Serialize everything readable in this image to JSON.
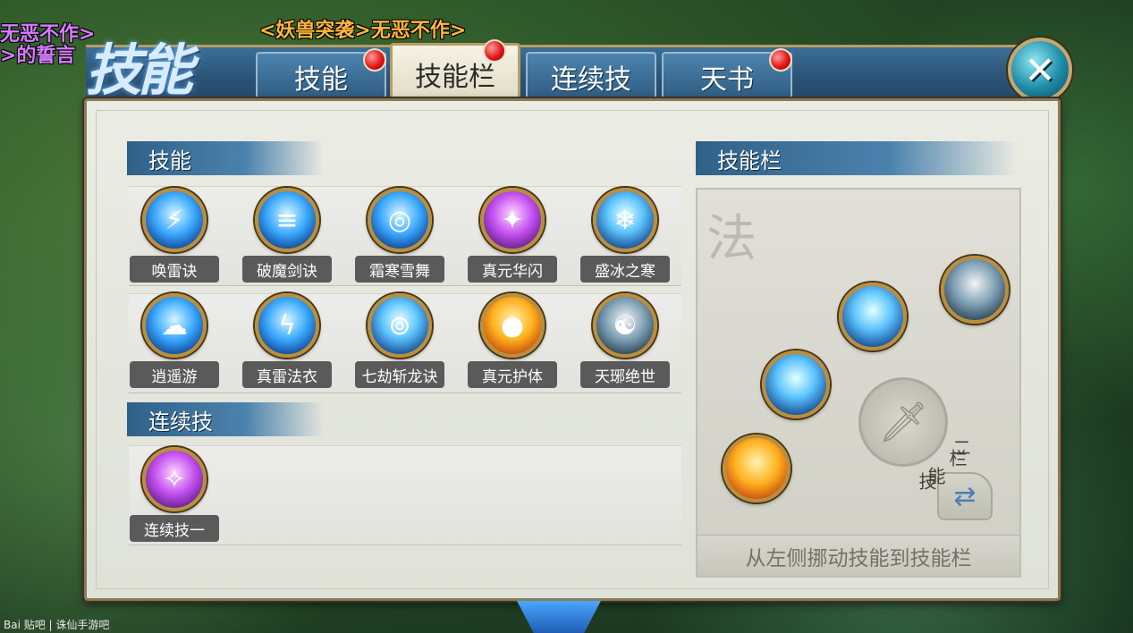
{
  "header": {
    "title_glyph": "技能",
    "tabs": [
      {
        "label": "技能",
        "badge": true,
        "active": false
      },
      {
        "label": "技能栏",
        "badge": true,
        "active": true
      },
      {
        "label": "连续技",
        "badge": false,
        "active": false
      },
      {
        "label": "天书",
        "badge": true,
        "active": false
      }
    ],
    "close_label": "✕"
  },
  "chat": {
    "line1": "<妖兽突袭>无恶不作>",
    "line_left1": "无恶不作>",
    "line_left2": ">的誓言"
  },
  "skills_section": {
    "title": "技能",
    "rows": [
      [
        {
          "name": "唤雷诀",
          "icon": "lightning-icon",
          "style": "blue"
        },
        {
          "name": "破魔剑诀",
          "icon": "sword-beam-icon",
          "style": "blue"
        },
        {
          "name": "霜寒雪舞",
          "icon": "vortex-icon",
          "style": "blue"
        },
        {
          "name": "真元华闪",
          "icon": "purple-burst-icon",
          "style": "purple"
        },
        {
          "name": "盛冰之寒",
          "icon": "ice-crystal-icon",
          "style": "ice"
        }
      ],
      [
        {
          "name": "逍遥游",
          "icon": "wind-icon",
          "style": "blue"
        },
        {
          "name": "真雷法衣",
          "icon": "thunder-armor-icon",
          "style": "blue"
        },
        {
          "name": "七劫斩龙诀",
          "icon": "ripple-icon",
          "style": "ice"
        },
        {
          "name": "真元护体",
          "icon": "orange-orb-icon",
          "style": "orange"
        },
        {
          "name": "天琊绝世",
          "icon": "taiji-icon",
          "style": "taiji"
        }
      ]
    ]
  },
  "combo_section": {
    "title": "连续技",
    "items": [
      {
        "name": "连续技一",
        "icon": "purple-crystal-icon",
        "style": "purple"
      }
    ]
  },
  "skillbar_section": {
    "title": "技能栏",
    "calligraphy": "法",
    "hint": "从左侧挪动技能到技能栏",
    "switch_label": "技能栏二",
    "switch_chars": [
      "技",
      "能",
      "栏",
      "二"
    ]
  },
  "watermark": "Bai 贴吧 | 诛仙手游吧"
}
